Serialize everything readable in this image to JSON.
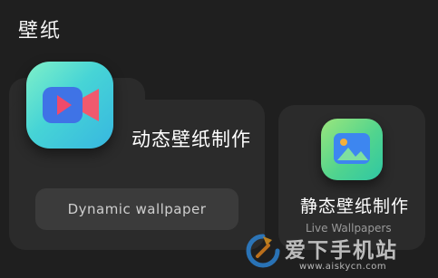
{
  "page": {
    "title": "壁纸"
  },
  "dynamic_card": {
    "title": "动态壁纸制作",
    "button_label": "Dynamic wallpaper",
    "icon": "video-camera-icon"
  },
  "static_card": {
    "title": "静态壁纸制作",
    "subtitle": "Live Wallpapers",
    "icon": "image-icon"
  },
  "watermark": {
    "title": "爱下手机站",
    "url": "www.aiskycn.com"
  },
  "colors": {
    "background": "#1f1f1f",
    "card": "#2b2b2b",
    "button": "#3b3b3b",
    "video_icon_gradient": [
      "#7ff0c8",
      "#37b7e0"
    ],
    "image_icon_gradient": [
      "#9be67c",
      "#2fc7a4"
    ]
  }
}
